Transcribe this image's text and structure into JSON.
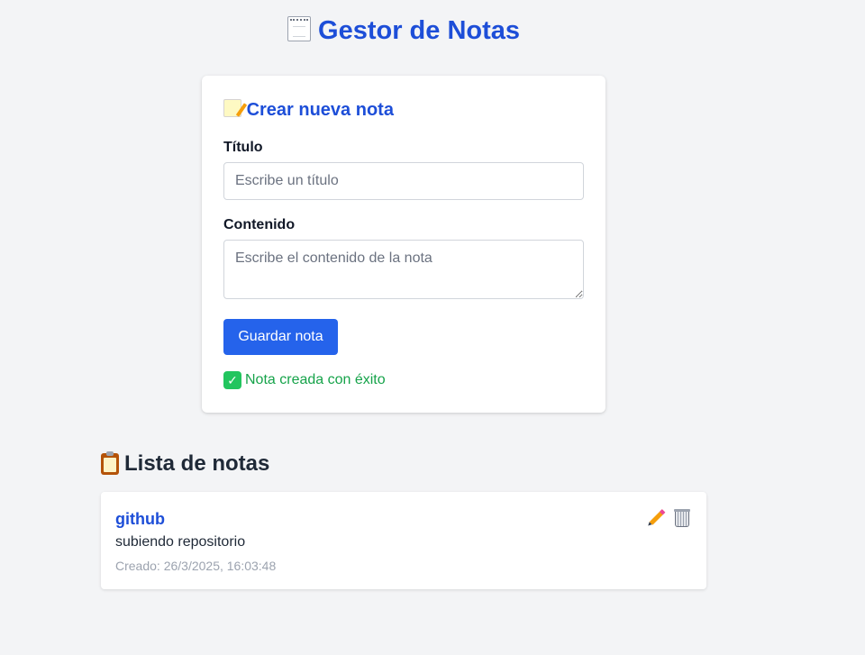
{
  "header": {
    "title": "Gestor de Notas",
    "icon": "notepad-icon"
  },
  "form": {
    "heading": "Crear nueva nota",
    "heading_icon": "memo-icon",
    "title_label": "Título",
    "title_placeholder": "Escribe un título",
    "title_value": "",
    "content_label": "Contenido",
    "content_placeholder": "Escribe el contenido de la nota",
    "content_value": "",
    "save_label": "Guardar nota",
    "success_message": "Nota creada con éxito",
    "success_icon": "check-icon"
  },
  "list": {
    "heading": "Lista de notas",
    "heading_icon": "clipboard-icon",
    "notes": [
      {
        "title": "github",
        "content": "subiendo repositorio",
        "created": "Creado: 26/3/2025, 16:03:48",
        "edit_icon": "pencil-icon",
        "delete_icon": "trash-icon"
      }
    ]
  },
  "colors": {
    "background": "#f3f4f6",
    "accent": "#1d4ed8",
    "button": "#2563eb",
    "success": "#16a34a"
  }
}
